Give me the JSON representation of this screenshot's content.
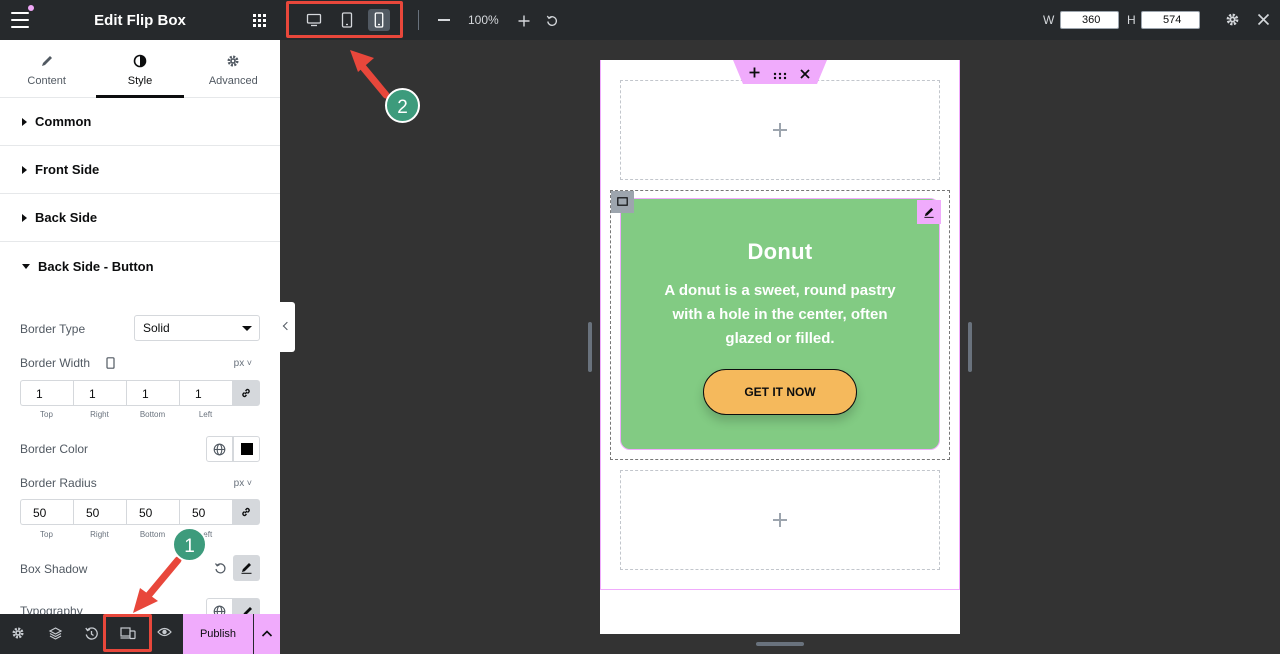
{
  "panel": {
    "title": "Edit Flip Box",
    "tabs": [
      {
        "label": "Content",
        "icon": "pencil-icon"
      },
      {
        "label": "Style",
        "icon": "half-circle-icon"
      },
      {
        "label": "Advanced",
        "icon": "gear-icon"
      }
    ],
    "sections": [
      {
        "label": "Common"
      },
      {
        "label": "Front Side"
      },
      {
        "label": "Back Side"
      },
      {
        "label": "Back Side - Button"
      }
    ],
    "border_type": {
      "label": "Border Type",
      "value": "Solid"
    },
    "border_width": {
      "label": "Border Width",
      "unit": "px",
      "values": [
        "1",
        "1",
        "1",
        "1"
      ],
      "sides": [
        "Top",
        "Right",
        "Bottom",
        "Left"
      ]
    },
    "border_color": {
      "label": "Border Color",
      "swatch": "#000000"
    },
    "border_radius": {
      "label": "Border Radius",
      "unit": "px",
      "values": [
        "50",
        "50",
        "50",
        "50"
      ],
      "sides": [
        "Top",
        "Right",
        "Bottom",
        "Left"
      ]
    },
    "box_shadow": {
      "label": "Box Shadow"
    },
    "typography": {
      "label": "Typography"
    }
  },
  "footer": {
    "publish_label": "Publish"
  },
  "topbar": {
    "zoom": "100%",
    "width_label": "W",
    "width_value": "360",
    "height_label": "H",
    "height_value": "574"
  },
  "flipbox": {
    "title": "Donut",
    "description": "A donut is a sweet, round pastry with a hole in the center, often glazed or filled.",
    "button_label": "GET IT NOW",
    "bg_color": "#82cb83",
    "button_color": "#f5b95c"
  },
  "annotations": [
    {
      "number": "1"
    },
    {
      "number": "2"
    }
  ],
  "colors": {
    "accent": "#f0abfc",
    "annotation_red": "#e8473b",
    "annotation_badge": "#3d9b7c"
  }
}
